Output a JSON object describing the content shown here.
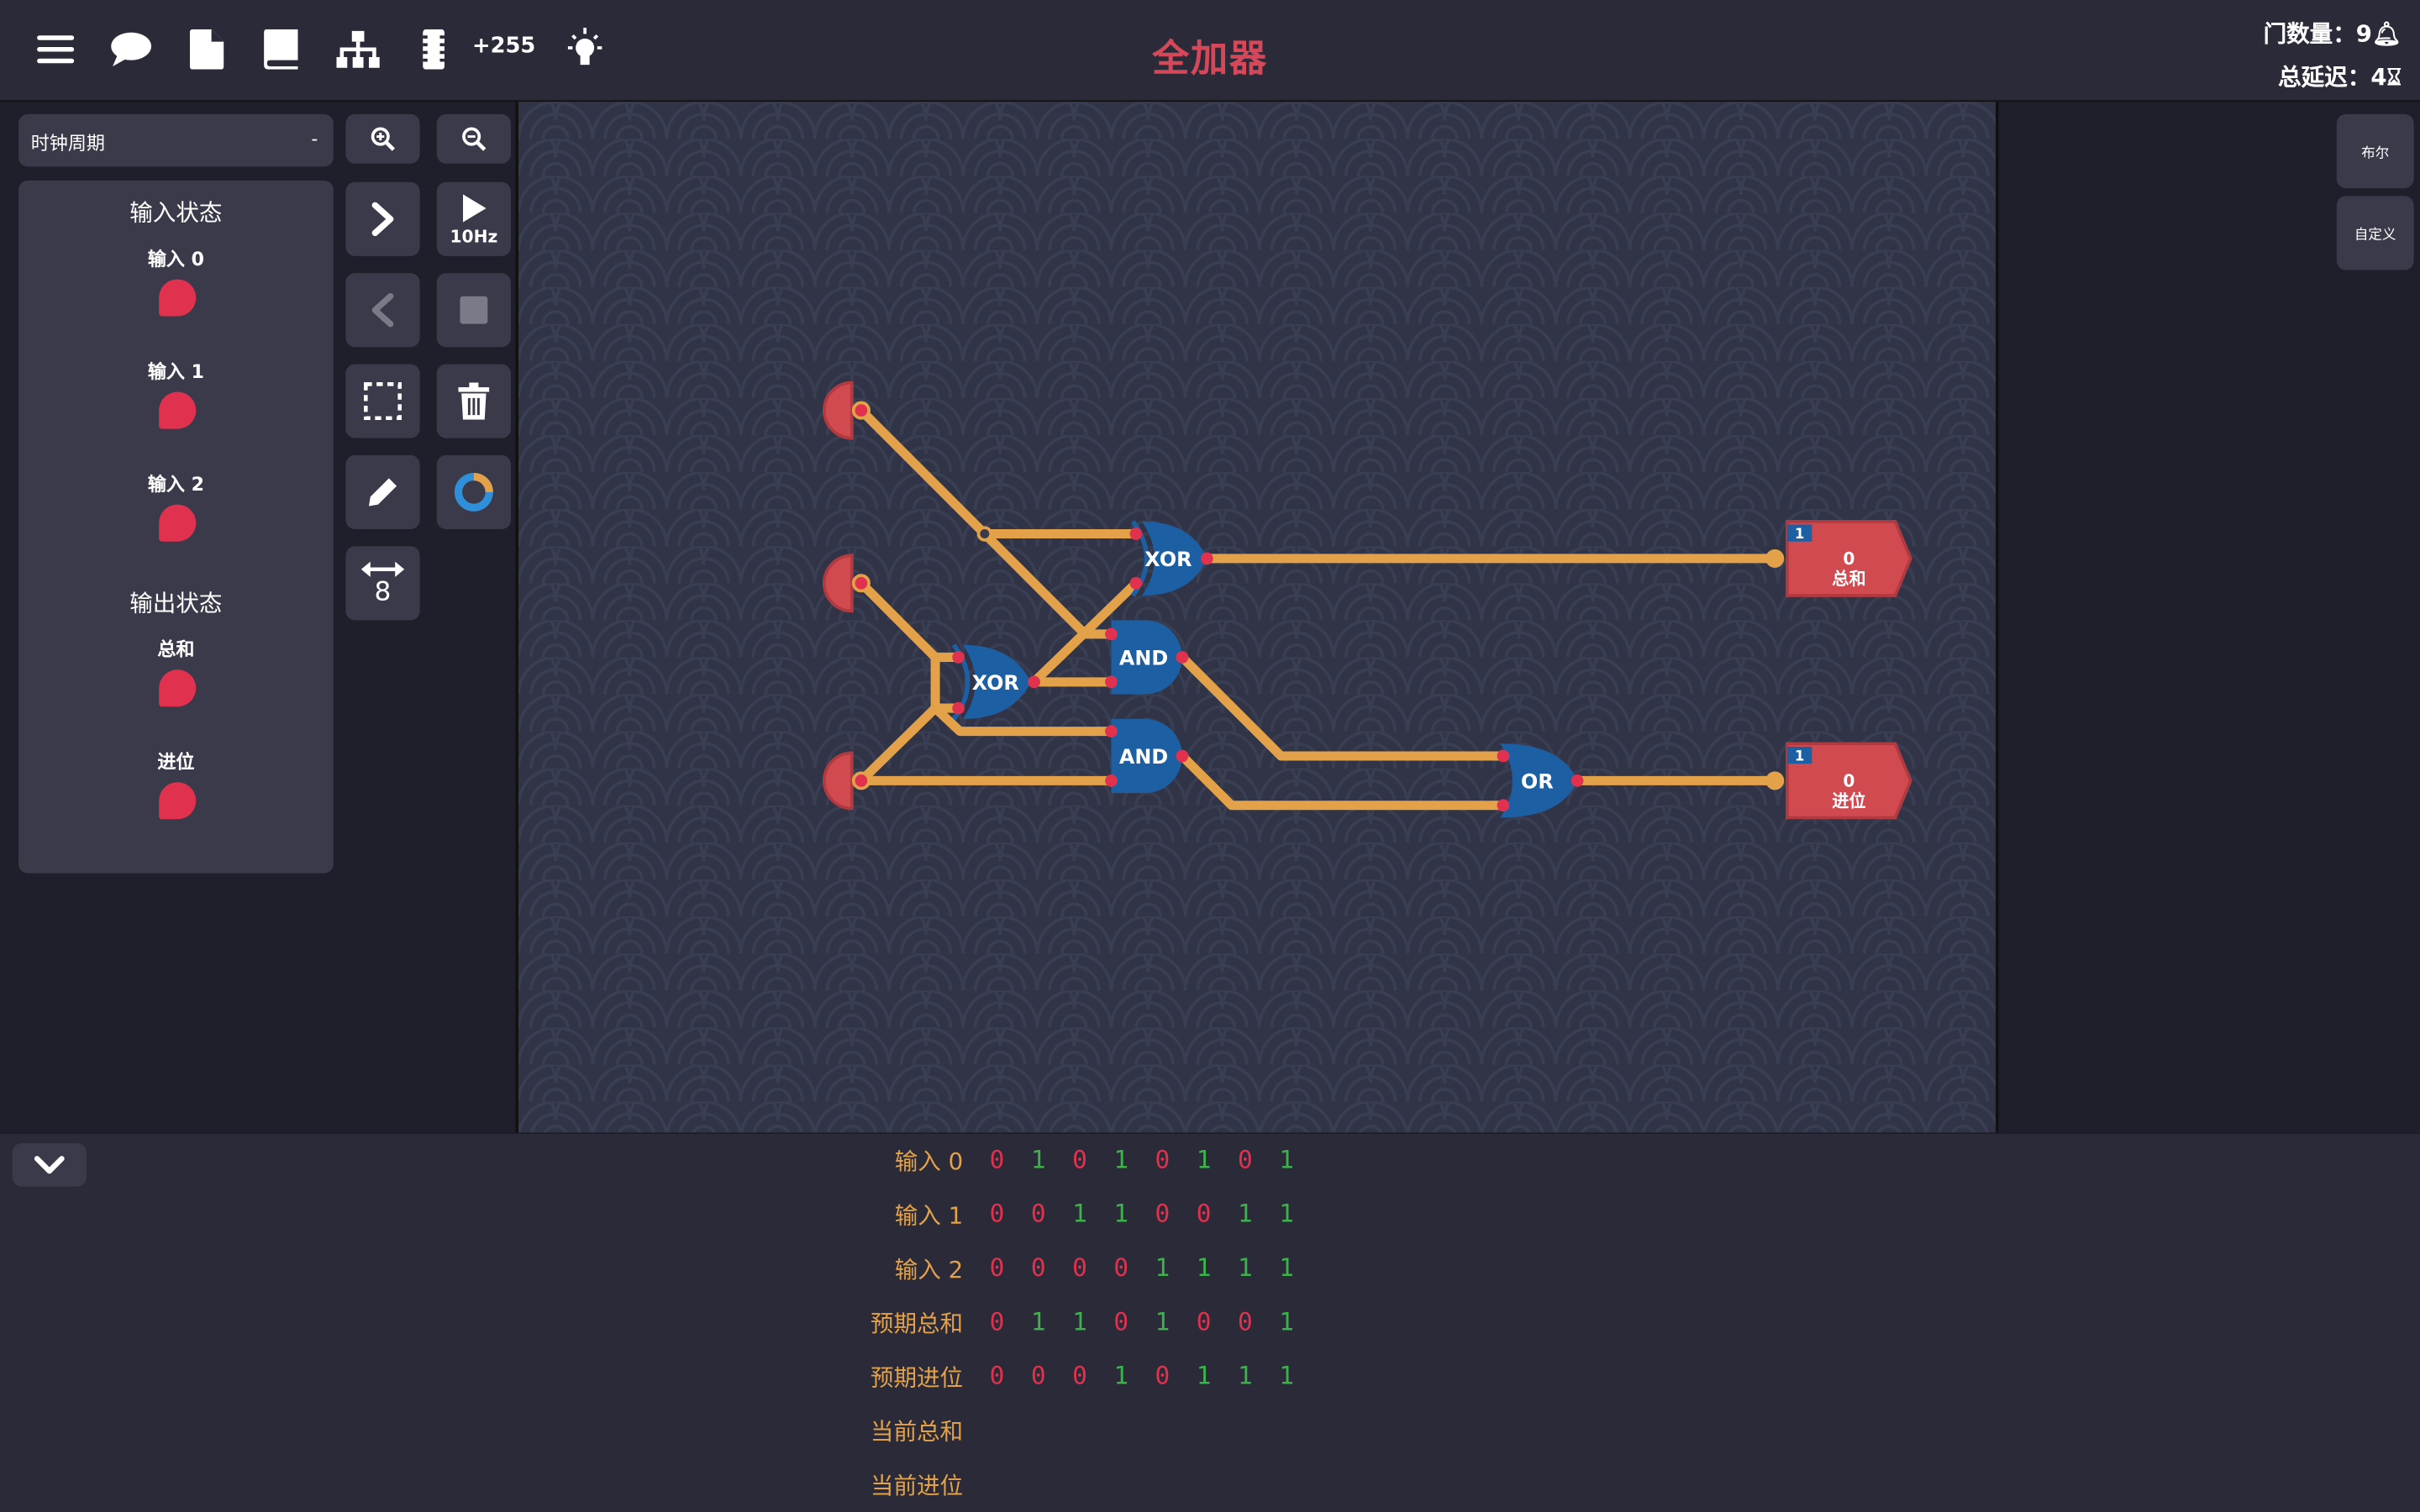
{
  "header": {
    "title": "全加器",
    "gate_count_label": "门数量：",
    "gate_count": "9",
    "delay_label": "总延迟：",
    "delay": "4",
    "toolbar_count": "+255",
    "toolbar_icons": [
      "menu-icon",
      "chat-icon",
      "file-icon",
      "book-icon",
      "hierarchy-icon",
      "chip-icon",
      "lightbulb-icon"
    ]
  },
  "left_panel": {
    "clock_label": "时钟周期",
    "clock_value": "-",
    "input_state_title": "输入状态",
    "inputs": [
      {
        "label": "输入 0"
      },
      {
        "label": "输入 1"
      },
      {
        "label": "输入 2"
      }
    ],
    "output_state_title": "输出状态",
    "outputs": [
      {
        "label": "总和"
      },
      {
        "label": "进位"
      }
    ]
  },
  "tools": {
    "speed_label": "10Hz",
    "bit_width": "8"
  },
  "right_panel": {
    "tabs": [
      "布尔",
      "自定义"
    ]
  },
  "circuit": {
    "gates": [
      "XOR",
      "XOR",
      "AND",
      "AND",
      "OR"
    ],
    "outputs": [
      {
        "value": "0",
        "label": "总和",
        "bits": "1"
      },
      {
        "value": "0",
        "label": "进位",
        "bits": "1"
      }
    ]
  },
  "truth_table": {
    "rows": [
      {
        "label": "输入 0",
        "values": [
          0,
          1,
          0,
          1,
          0,
          1,
          0,
          1
        ]
      },
      {
        "label": "输入 1",
        "values": [
          0,
          0,
          1,
          1,
          0,
          0,
          1,
          1
        ]
      },
      {
        "label": "输入 2",
        "values": [
          0,
          0,
          0,
          0,
          1,
          1,
          1,
          1
        ]
      },
      {
        "label": "预期总和",
        "values": [
          0,
          1,
          1,
          0,
          1,
          0,
          0,
          1
        ]
      },
      {
        "label": "预期进位",
        "values": [
          0,
          0,
          0,
          1,
          0,
          1,
          1,
          1
        ]
      },
      {
        "label": "当前总和",
        "values": []
      },
      {
        "label": "当前进位",
        "values": []
      }
    ]
  },
  "colors": {
    "accent": "#d4485a",
    "wire": "#e3a24a",
    "gate": "#1d5fa3",
    "led_off": "#e0314e",
    "bit_zero": "#e0314e",
    "bit_one": "#3bb34a"
  }
}
